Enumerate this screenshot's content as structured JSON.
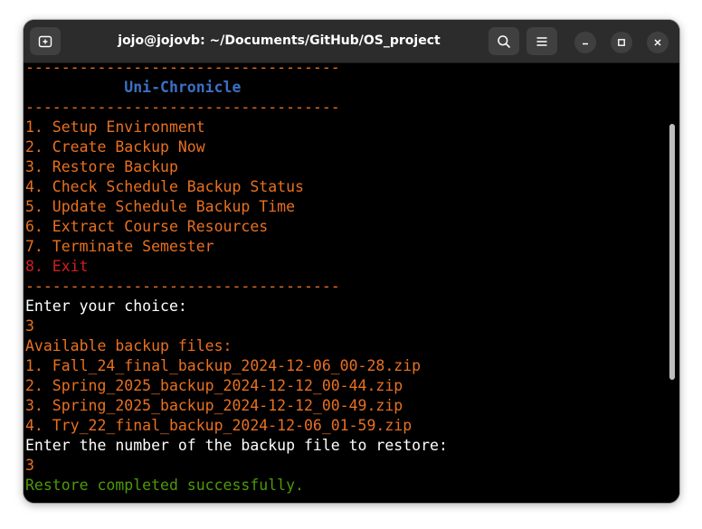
{
  "window": {
    "title": "jojo@jojovb: ~/Documents/GitHub/OS_project"
  },
  "icons": {
    "new_tab": "new-tab-icon",
    "search": "search-icon",
    "menu": "hamburger-menu-icon",
    "minimize": "minimize-icon",
    "maximize": "maximize-icon",
    "close": "close-icon"
  },
  "colors": {
    "orange": "#e9701f",
    "red": "#d21f1f",
    "green": "#4e9a06",
    "blue": "#3d6fc4",
    "white": "#ffffff",
    "background": "#000000"
  },
  "terminal": {
    "lines": [
      {
        "text": "-----------------------------------",
        "color": "orange"
      },
      {
        "text": "           Uni-Chronicle",
        "color": "blue"
      },
      {
        "text": "-----------------------------------",
        "color": "orange"
      },
      {
        "text": "1. Setup Environment",
        "color": "orange"
      },
      {
        "text": "2. Create Backup Now",
        "color": "orange"
      },
      {
        "text": "3. Restore Backup",
        "color": "orange"
      },
      {
        "text": "4. Check Schedule Backup Status",
        "color": "orange"
      },
      {
        "text": "5. Update Schedule Backup Time",
        "color": "orange"
      },
      {
        "text": "6. Extract Course Resources",
        "color": "orange"
      },
      {
        "text": "7. Terminate Semester",
        "color": "orange"
      },
      {
        "text": "8. Exit",
        "color": "red"
      },
      {
        "text": "-----------------------------------",
        "color": "orange"
      },
      {
        "text": "Enter your choice:",
        "color": "white"
      },
      {
        "text": "3",
        "color": "orange"
      },
      {
        "text": "Available backup files:",
        "color": "orange"
      },
      {
        "text": "1. Fall_24_final_backup_2024-12-06_00-28.zip",
        "color": "orange"
      },
      {
        "text": "2. Spring_2025_backup_2024-12-12_00-44.zip",
        "color": "orange"
      },
      {
        "text": "3. Spring_2025_backup_2024-12-12_00-49.zip",
        "color": "orange"
      },
      {
        "text": "4. Try_22_final_backup_2024-12-06_01-59.zip",
        "color": "orange"
      },
      {
        "text": "Enter the number of the backup file to restore:",
        "color": "white"
      },
      {
        "text": "3",
        "color": "orange"
      },
      {
        "text": "Restore completed successfully.",
        "color": "green"
      }
    ]
  }
}
